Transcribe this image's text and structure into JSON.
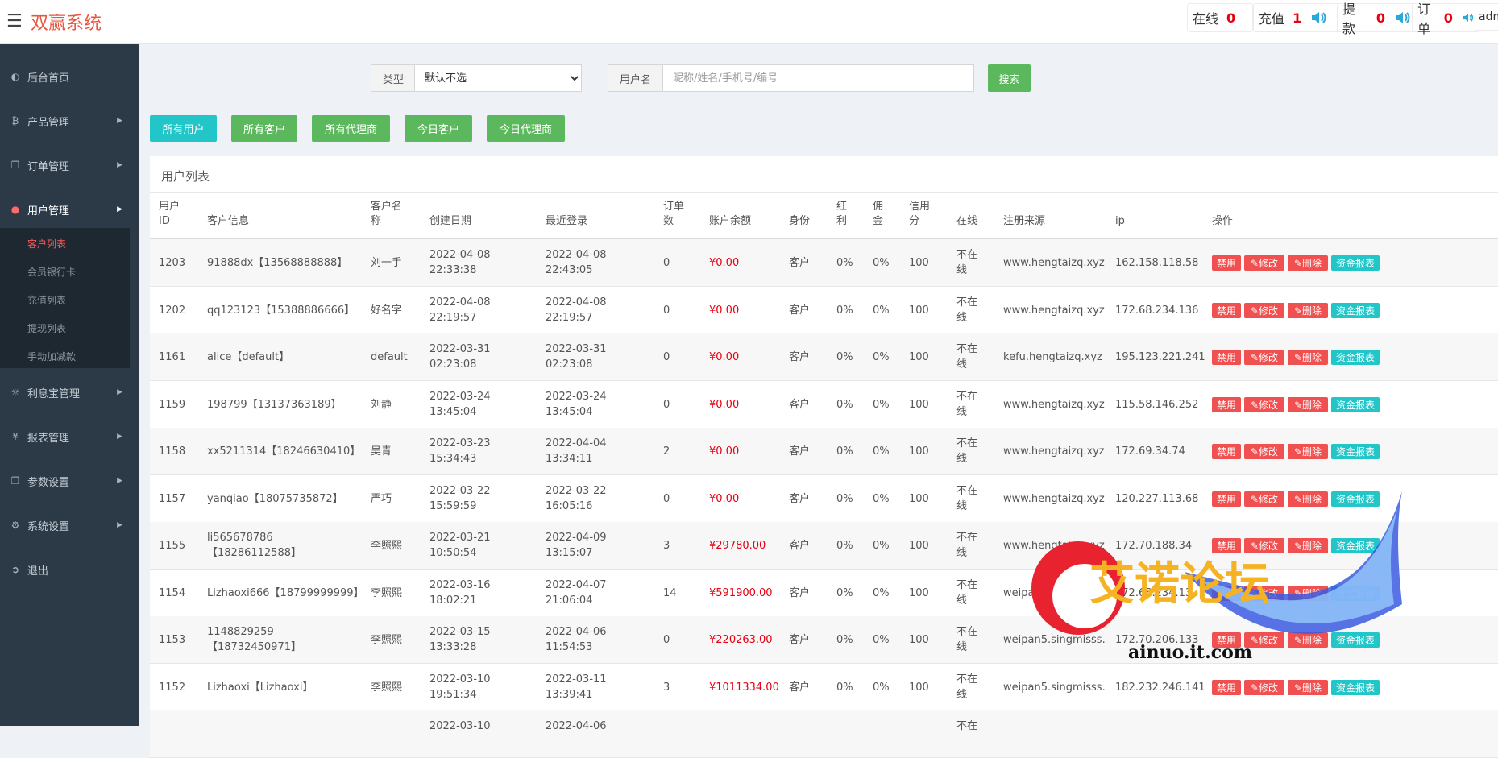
{
  "app": {
    "title": "双赢系统"
  },
  "header": {
    "stats": [
      {
        "label": "在线",
        "value": "0"
      },
      {
        "label": "充值",
        "value": "1"
      },
      {
        "label": "提款",
        "value": "0"
      },
      {
        "label": "订单",
        "value": "0"
      }
    ],
    "admin": "admin"
  },
  "sidebar": {
    "items": [
      {
        "label": "后台首页",
        "icon": "dashboard-icon"
      },
      {
        "label": "产品管理",
        "icon": "bitcoin-icon"
      },
      {
        "label": "订单管理",
        "icon": "copy-icon"
      },
      {
        "label": "用户管理",
        "icon": "user-icon"
      },
      {
        "label": "利息宝管理",
        "icon": "globe-icon"
      },
      {
        "label": "报表管理",
        "icon": "yen-icon"
      },
      {
        "label": "参数设置",
        "icon": "copy-icon"
      },
      {
        "label": "系统设置",
        "icon": "gears-icon"
      },
      {
        "label": "退出",
        "icon": "sign-out-icon"
      }
    ],
    "submenu": [
      "客户列表",
      "会员银行卡",
      "充值列表",
      "提现列表",
      "手动加减款"
    ]
  },
  "search": {
    "type_label": "类型",
    "type_value": "默认不选",
    "username_label": "用户名",
    "username_placeholder": "昵称/姓名/手机号/编号",
    "button": "搜索"
  },
  "filters": [
    "所有用户",
    "所有客户",
    "所有代理商",
    "今日客户",
    "今日代理商"
  ],
  "panel": {
    "title": "用户列表"
  },
  "table": {
    "headers": {
      "id": [
        "用户",
        "ID"
      ],
      "info": "客户信息",
      "name": [
        "客户名",
        "称"
      ],
      "created": "创建日期",
      "login": "最近登录",
      "orders": [
        "订单",
        "数"
      ],
      "balance": "账户余额",
      "role": "身份",
      "bonus": [
        "红",
        "利"
      ],
      "commission": [
        "佣",
        "金"
      ],
      "credit": [
        "信用",
        "分"
      ],
      "online": "在线",
      "source": "注册来源",
      "ip": "ip",
      "ops": "操作"
    },
    "actions": [
      "禁用",
      "✎修改",
      "✎删除",
      "资金报表"
    ],
    "rows": [
      {
        "id": "1203",
        "info": [
          "91888dx【13568888888】"
        ],
        "name": "刘一手",
        "created": [
          "2022-04-08",
          "22:33:38"
        ],
        "login": [
          "2022-04-08",
          "22:43:05"
        ],
        "orders": "0",
        "balance": "¥0.00",
        "role": "客户",
        "bonus": "0%",
        "commission": "0%",
        "credit": "100",
        "online": [
          "不在",
          "线"
        ],
        "source": "www.hengtaizq.xyz",
        "ip": "162.158.118.58"
      },
      {
        "id": "1202",
        "info": [
          "qq123123【15388886666】"
        ],
        "name": "好名字",
        "created": [
          "2022-04-08",
          "22:19:57"
        ],
        "login": [
          "2022-04-08",
          "22:19:57"
        ],
        "orders": "0",
        "balance": "¥0.00",
        "role": "客户",
        "bonus": "0%",
        "commission": "0%",
        "credit": "100",
        "online": [
          "不在",
          "线"
        ],
        "source": "www.hengtaizq.xyz",
        "ip": "172.68.234.136"
      },
      {
        "id": "1161",
        "info": [
          "alice【default】"
        ],
        "name": "default",
        "created": [
          "2022-03-31",
          "02:23:08"
        ],
        "login": [
          "2022-03-31",
          "02:23:08"
        ],
        "orders": "0",
        "balance": "¥0.00",
        "role": "客户",
        "bonus": "0%",
        "commission": "0%",
        "credit": "100",
        "online": [
          "不在",
          "线"
        ],
        "source": "kefu.hengtaizq.xyz",
        "ip": "195.123.221.241"
      },
      {
        "id": "1159",
        "info": [
          "198799【13137363189】"
        ],
        "name": "刘静",
        "created": [
          "2022-03-24",
          "13:45:04"
        ],
        "login": [
          "2022-03-24",
          "13:45:04"
        ],
        "orders": "0",
        "balance": "¥0.00",
        "role": "客户",
        "bonus": "0%",
        "commission": "0%",
        "credit": "100",
        "online": [
          "不在",
          "线"
        ],
        "source": "www.hengtaizq.xyz",
        "ip": "115.58.146.252"
      },
      {
        "id": "1158",
        "info": [
          "xx5211314【18246630410】"
        ],
        "name": "吴青",
        "created": [
          "2022-03-23",
          "15:34:43"
        ],
        "login": [
          "2022-04-04",
          "13:34:11"
        ],
        "orders": "2",
        "balance": "¥0.00",
        "role": "客户",
        "bonus": "0%",
        "commission": "0%",
        "credit": "100",
        "online": [
          "不在",
          "线"
        ],
        "source": "www.hengtaizq.xyz",
        "ip": "172.69.34.74"
      },
      {
        "id": "1157",
        "info": [
          "yanqiao【18075735872】"
        ],
        "name": "严巧",
        "created": [
          "2022-03-22",
          "15:59:59"
        ],
        "login": [
          "2022-03-22",
          "16:05:16"
        ],
        "orders": "0",
        "balance": "¥0.00",
        "role": "客户",
        "bonus": "0%",
        "commission": "0%",
        "credit": "100",
        "online": [
          "不在",
          "线"
        ],
        "source": "www.hengtaizq.xyz",
        "ip": "120.227.113.68"
      },
      {
        "id": "1155",
        "info": [
          "li565678786",
          "【18286112588】"
        ],
        "name": "李照熙",
        "created": [
          "2022-03-21",
          "10:50:54"
        ],
        "login": [
          "2022-04-09",
          "13:15:07"
        ],
        "orders": "3",
        "balance": "¥29780.00",
        "role": "客户",
        "bonus": "0%",
        "commission": "0%",
        "credit": "100",
        "online": [
          "不在",
          "线"
        ],
        "source": "www.hengtaizq.xyz",
        "ip": "172.70.188.34"
      },
      {
        "id": "1154",
        "info": [
          "Lizhaoxi666【18799999999】"
        ],
        "name": "李照熙",
        "created": [
          "2022-03-16",
          "18:02:21"
        ],
        "login": [
          "2022-04-07",
          "21:06:04"
        ],
        "orders": "14",
        "balance": "¥591900.00",
        "role": "客户",
        "bonus": "0%",
        "commission": "0%",
        "credit": "100",
        "online": [
          "不在",
          "线"
        ],
        "source": "weipan5.singmisss.",
        "ip": "172.68.234.13"
      },
      {
        "id": "1153",
        "info": [
          "1148829259",
          "【18732450971】"
        ],
        "name": "李照熙",
        "created": [
          "2022-03-15",
          "13:33:28"
        ],
        "login": [
          "2022-04-06",
          "11:54:53"
        ],
        "orders": "0",
        "balance": "¥220263.00",
        "role": "客户",
        "bonus": "0%",
        "commission": "0%",
        "credit": "100",
        "online": [
          "不在",
          "线"
        ],
        "source": "weipan5.singmisss.",
        "ip": "172.70.206.133"
      },
      {
        "id": "1152",
        "info": [
          "Lizhaoxi【Lizhaoxi】"
        ],
        "name": "李照熙",
        "created": [
          "2022-03-10",
          "19:51:34"
        ],
        "login": [
          "2022-03-11",
          "13:39:41"
        ],
        "orders": "3",
        "balance": "¥1011334.00",
        "role": "客户",
        "bonus": "0%",
        "commission": "0%",
        "credit": "100",
        "online": [
          "不在",
          "线"
        ],
        "source": "weipan5.singmisss.",
        "ip": "182.232.246.141"
      },
      {
        "id": "",
        "info": [
          ""
        ],
        "name": "",
        "created": [
          "2022-03-10",
          ""
        ],
        "login": [
          "2022-04-06",
          ""
        ],
        "orders": "",
        "balance": "",
        "role": "",
        "bonus": "",
        "commission": "",
        "credit": "",
        "online": [
          "不在",
          ""
        ],
        "source": "",
        "ip": ""
      }
    ]
  },
  "watermark": {
    "text": "艾诺论坛",
    "url": "ainuo.it.com"
  },
  "colors": {
    "brand": "#e9573f",
    "teal": "#23c6c8",
    "green": "#5cb85c",
    "danger": "#f05050",
    "money": "#e60012",
    "sidebar": "#2c3a47"
  }
}
